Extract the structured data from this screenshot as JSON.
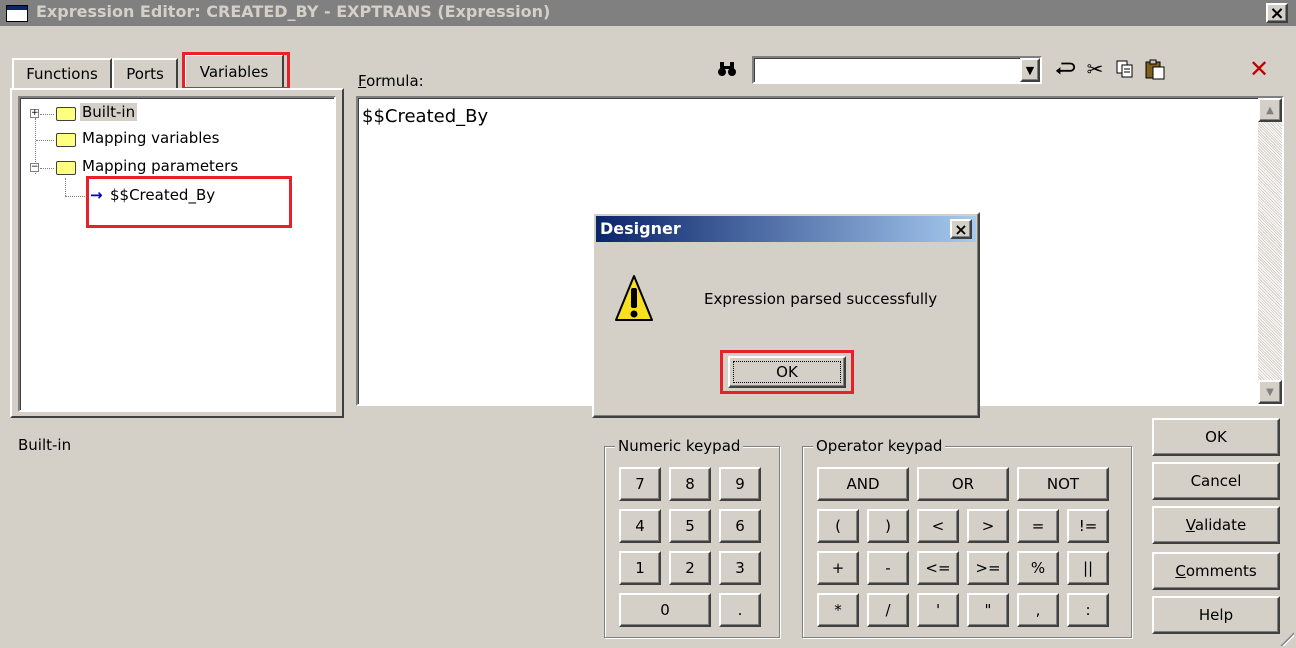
{
  "window": {
    "title": "Expression Editor: CREATED_BY - EXPTRANS (Expression)",
    "close_glyph": "×"
  },
  "tabs": [
    {
      "label": "Functions"
    },
    {
      "label": "Ports"
    },
    {
      "label": "Variables",
      "selected": true
    }
  ],
  "tree": {
    "items": [
      {
        "label": "Built-in",
        "expander": "+"
      },
      {
        "label": "Mapping variables"
      },
      {
        "label": "Mapping parameters",
        "expander": "−"
      },
      {
        "label": "$$Created_By",
        "icon": "arrow-right-icon"
      }
    ],
    "description": "Built-in"
  },
  "formula": {
    "label_first": "F",
    "label_rest": "ormula:",
    "text": "$$Created_By",
    "search_value": ""
  },
  "toolbar_icons": [
    "binoculars-icon",
    "undo-icon",
    "cut-icon",
    "copy-icon",
    "paste-icon",
    "delete-icon"
  ],
  "numeric_keypad": {
    "label": "Numeric keypad",
    "keys": [
      "7",
      "8",
      "9",
      "4",
      "5",
      "6",
      "1",
      "2",
      "3",
      "0",
      "."
    ]
  },
  "operator_keypad": {
    "label": "Operator keypad",
    "row1": [
      "AND",
      "OR",
      "NOT"
    ],
    "keys": [
      "(",
      ")",
      "<",
      ">",
      "=",
      "!=",
      "+",
      "-",
      "<=",
      ">=",
      "%",
      "||",
      "*",
      "/",
      "'",
      "\"",
      ",",
      ":"
    ]
  },
  "side_buttons": {
    "ok": "OK",
    "cancel": "Cancel",
    "validate_first": "V",
    "validate_rest": "alidate",
    "comments_first": "C",
    "comments_rest": "omments",
    "help": "Help"
  },
  "dialog": {
    "title": "Designer",
    "message": "Expression parsed successfully",
    "ok": "OK",
    "icon": "warning-icon"
  },
  "colors": {
    "highlight": "#e8202a",
    "dialog_title_start": "#0a246a",
    "dialog_title_end": "#a6caf0",
    "window_title_inactive": "#808080"
  }
}
